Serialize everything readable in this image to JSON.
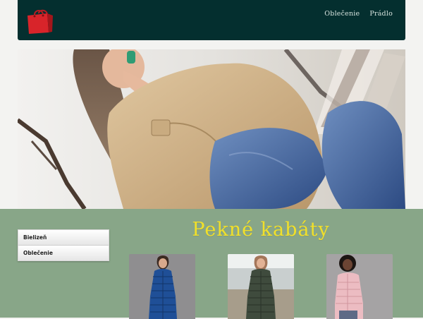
{
  "header": {
    "logo_icon": "red-shopping-bag-icon",
    "nav": [
      {
        "label": "Oblečenie"
      },
      {
        "label": "Prádlo"
      }
    ]
  },
  "hero": {
    "image": "woman-in-beige-trench-coat-with-phone"
  },
  "sidebar": {
    "items": [
      {
        "label": "Bielizeň"
      },
      {
        "label": "Oblečenie"
      }
    ]
  },
  "main": {
    "title": "Pekné kabáty",
    "products": [
      {
        "image": "woman-in-blue-quilted-coat"
      },
      {
        "image": "woman-in-olive-quilted-coat"
      },
      {
        "image": "woman-in-pink-quilted-jacket"
      }
    ]
  },
  "colors": {
    "header_bg": "#042f2f",
    "section_bg": "#88a688",
    "title_color": "#f1e02a",
    "logo_red": "#d8242a"
  }
}
